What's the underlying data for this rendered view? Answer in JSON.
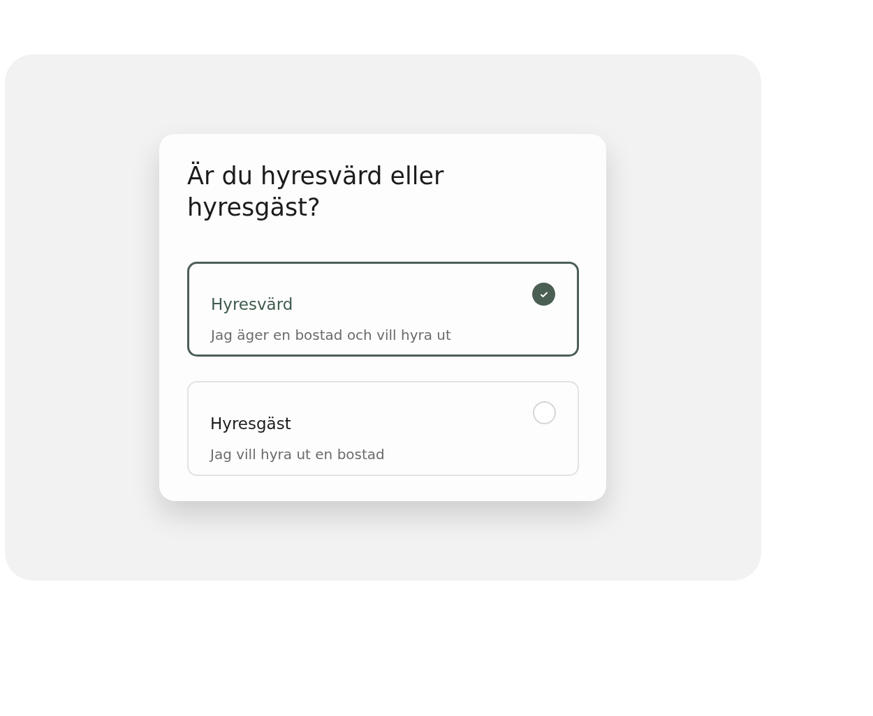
{
  "title": "Är du hyresvärd eller hyresgäst?",
  "options": [
    {
      "title": "Hyresvärd",
      "description": "Jag äger en bostad och vill hyra ut",
      "selected": true
    },
    {
      "title": "Hyresgäst",
      "description": "Jag vill hyra ut en bostad",
      "selected": false
    }
  ]
}
